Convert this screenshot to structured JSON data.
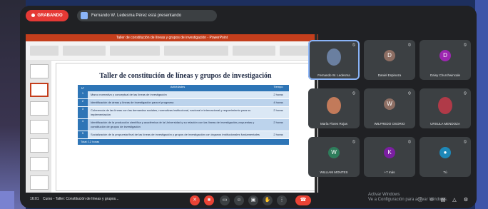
{
  "meet": {
    "recording_label": "GRABANDO",
    "presenting_label": "Fernando W. Ledesma Pérez está presentando",
    "time": "16:01",
    "meeting_title": "Curso - Taller: Constitución de líneas y grupos...",
    "activate_windows_line1": "Activar Windows",
    "activate_windows_line2": "Ve a Configuración para activar Windows."
  },
  "ppt": {
    "window_title": "Taller de constitución de líneas y grupos de investigación - PowerPoint"
  },
  "slide": {
    "title": "Taller de constitución de líneas y grupos de investigación",
    "table": {
      "header": [
        "N°",
        "Actividades",
        "Tiempo"
      ],
      "rows": [
        {
          "num": "1",
          "activity": "Marco normativo y conceptual de las líneas de investigación",
          "time": "2 horas"
        },
        {
          "num": "2",
          "activity": "Identificación de áreas y líneas de investigación para el programa",
          "time": "4 horas"
        },
        {
          "num": "3",
          "activity": "Coherencia de las líneas con las demandas sociales, normativas institucional, nacional e internacional y requerimiento para su implementación",
          "time": "2 horas"
        },
        {
          "num": "4",
          "activity": "Identificación de la producción científica y académica de la Universidad y su relación con las líneas de investigación propuestas y constitución de grupos de investigación",
          "time": "2 horas"
        },
        {
          "num": "5",
          "activity": "Socialización de la propuesta final de las líneas de investigación y grupos de investigación con órganos institucionales fundamentales",
          "time": "2 horas"
        }
      ],
      "footer": "Total: 12 horas"
    }
  },
  "participants": [
    {
      "name": "Fernando W. Ledesma",
      "kind": "photo",
      "color": "#6a7fa0"
    },
    {
      "name": "Daniel Espinoza",
      "kind": "avatar",
      "initial": "D",
      "color": "#8d6e63"
    },
    {
      "name": "Daisy Churchwincale",
      "kind": "avatar",
      "initial": "D",
      "color": "#9c27b0"
    },
    {
      "name": "María Flores Rojas",
      "kind": "photo",
      "color": "#c27a5a"
    },
    {
      "name": "WILFREDO OSORIO",
      "kind": "avatar",
      "initial": "W",
      "color": "#8d6e63"
    },
    {
      "name": "URSULA MENDOZA",
      "kind": "photo",
      "color": "#b03a48"
    },
    {
      "name": "WILLIAM MONTES",
      "kind": "avatar",
      "initial": "W",
      "color": "#2e7d5b"
    },
    {
      "name": "+7 más",
      "kind": "avatar",
      "initial": "K",
      "color": "#7b1fa2"
    },
    {
      "name": "Tú",
      "kind": "avatar",
      "initial": "●",
      "color": "#1e88b8"
    }
  ],
  "colors": {
    "accent": "#ea4335",
    "slide_table": "#2e75b6",
    "ppt_red": "#c43e1c"
  }
}
